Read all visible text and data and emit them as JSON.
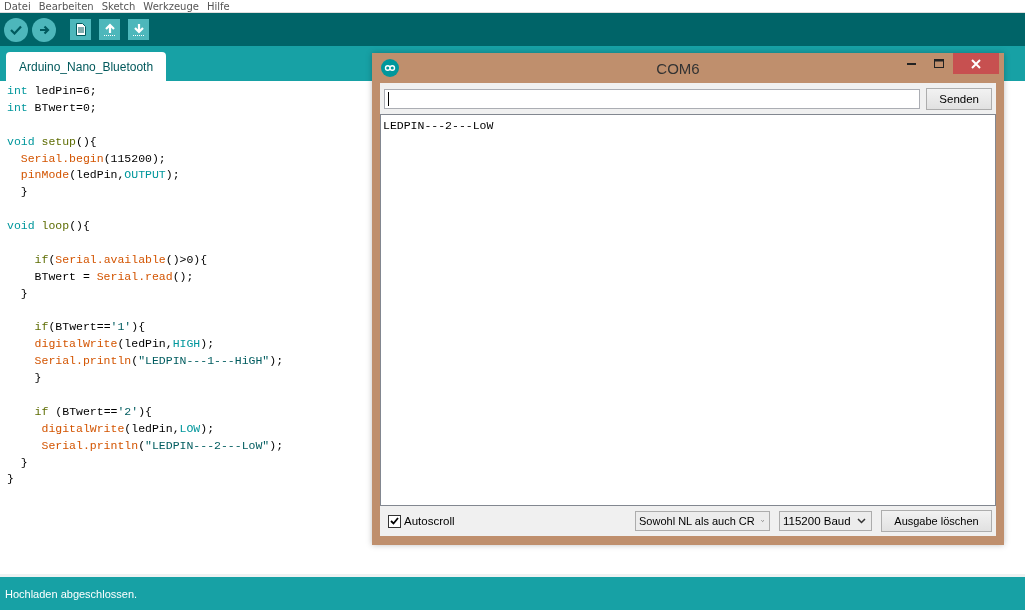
{
  "menu": [
    "Datei",
    "Bearbeiten",
    "Sketch",
    "Werkzeuge",
    "Hilfe"
  ],
  "tabs": [
    {
      "label": "Arduino_Nano_Bluetooth",
      "selected": true
    }
  ],
  "code": [
    {
      "kind": "code",
      "tokens": [
        {
          "text": "int",
          "kind": "type"
        },
        {
          "text": " ledPin=6;",
          "kind": "plain"
        }
      ]
    },
    {
      "kind": "code",
      "tokens": [
        {
          "text": "int",
          "kind": "type"
        },
        {
          "text": " BTwert=0;",
          "kind": "plain"
        }
      ]
    },
    {
      "kind": "blank"
    },
    {
      "kind": "code",
      "tokens": [
        {
          "text": "void",
          "kind": "type"
        },
        {
          "text": " setup",
          "kind": "func"
        },
        {
          "text": "(){",
          "kind": "plain"
        }
      ]
    },
    {
      "kind": "code",
      "tokens": [
        {
          "text": "  Serial.begin",
          "kind": "lib"
        },
        {
          "text": "(115200);",
          "kind": "plain"
        }
      ]
    },
    {
      "kind": "code",
      "tokens": [
        {
          "text": "  pinMode",
          "kind": "lib"
        },
        {
          "text": "(ledPin,",
          "kind": "plain"
        },
        {
          "text": "OUTPUT",
          "kind": "const"
        },
        {
          "text": ");",
          "kind": "plain"
        }
      ]
    },
    {
      "kind": "code",
      "tokens": [
        {
          "text": "  }",
          "kind": "plain"
        }
      ]
    },
    {
      "kind": "blank"
    },
    {
      "kind": "code",
      "tokens": [
        {
          "text": "void",
          "kind": "type"
        },
        {
          "text": " loop",
          "kind": "func"
        },
        {
          "text": "(){",
          "kind": "plain"
        }
      ]
    },
    {
      "kind": "blank"
    },
    {
      "kind": "code",
      "tokens": [
        {
          "text": "    if",
          "kind": "func"
        },
        {
          "text": "(",
          "kind": "plain"
        },
        {
          "text": "Serial.available",
          "kind": "lib"
        },
        {
          "text": "()>0){",
          "kind": "plain"
        }
      ]
    },
    {
      "kind": "code",
      "tokens": [
        {
          "text": "    BTwert = ",
          "kind": "plain"
        },
        {
          "text": "Serial.read",
          "kind": "lib"
        },
        {
          "text": "();",
          "kind": "plain"
        }
      ]
    },
    {
      "kind": "code",
      "tokens": [
        {
          "text": "  }",
          "kind": "plain"
        }
      ]
    },
    {
      "kind": "blank"
    },
    {
      "kind": "code",
      "tokens": [
        {
          "text": "    if",
          "kind": "func"
        },
        {
          "text": "(BTwert==",
          "kind": "plain"
        },
        {
          "text": "'1'",
          "kind": "string"
        },
        {
          "text": "){",
          "kind": "plain"
        }
      ]
    },
    {
      "kind": "code",
      "tokens": [
        {
          "text": "    digitalWrite",
          "kind": "lib"
        },
        {
          "text": "(ledPin,",
          "kind": "plain"
        },
        {
          "text": "HIGH",
          "kind": "const"
        },
        {
          "text": ");",
          "kind": "plain"
        }
      ]
    },
    {
      "kind": "code",
      "tokens": [
        {
          "text": "    Serial.println",
          "kind": "lib"
        },
        {
          "text": "(",
          "kind": "plain"
        },
        {
          "text": "\"LEDPIN---1---HiGH\"",
          "kind": "string"
        },
        {
          "text": ");",
          "kind": "plain"
        }
      ]
    },
    {
      "kind": "code",
      "tokens": [
        {
          "text": "    }",
          "kind": "plain"
        }
      ]
    },
    {
      "kind": "blank"
    },
    {
      "kind": "code",
      "tokens": [
        {
          "text": "    if",
          "kind": "func"
        },
        {
          "text": " (BTwert==",
          "kind": "plain"
        },
        {
          "text": "'2'",
          "kind": "string"
        },
        {
          "text": "){",
          "kind": "plain"
        }
      ]
    },
    {
      "kind": "code",
      "tokens": [
        {
          "text": "     digitalWrite",
          "kind": "lib"
        },
        {
          "text": "(ledPin,",
          "kind": "plain"
        },
        {
          "text": "LOW",
          "kind": "const"
        },
        {
          "text": ");",
          "kind": "plain"
        }
      ]
    },
    {
      "kind": "code",
      "tokens": [
        {
          "text": "     Serial.println",
          "kind": "lib"
        },
        {
          "text": "(",
          "kind": "plain"
        },
        {
          "text": "\"LEDPIN---2---LoW\"",
          "kind": "string"
        },
        {
          "text": ");",
          "kind": "plain"
        }
      ]
    },
    {
      "kind": "code",
      "tokens": [
        {
          "text": "  }",
          "kind": "plain"
        }
      ]
    },
    {
      "kind": "code",
      "tokens": [
        {
          "text": "}",
          "kind": "plain"
        }
      ]
    }
  ],
  "serial_monitor": {
    "title": "COM6",
    "send_button": "Senden",
    "output_lines": [
      "LEDPIN---2---LoW"
    ],
    "autoscroll": {
      "label": "Autoscroll",
      "checked": true
    },
    "line_ending": "Sowohl NL als auch CR",
    "baud_rate": "115200 Baud",
    "clear_button": "Ausgabe löschen"
  },
  "status_bar": "Hochladen abgeschlossen."
}
